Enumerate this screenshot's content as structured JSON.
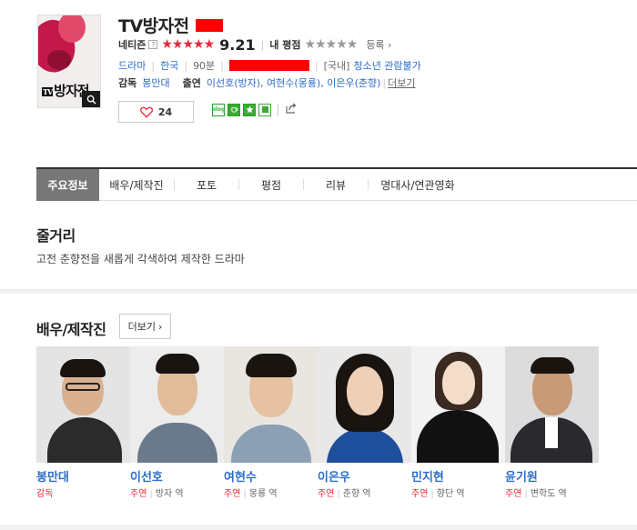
{
  "header": {
    "title": "TV방자전",
    "rating_label": "네티즌",
    "help_glyph": "?",
    "stars": "★★★★★",
    "score": "9.21",
    "my_rating_label": "내 평점",
    "my_stars": "★★★★★",
    "register_label": "등록"
  },
  "meta": {
    "genre": "드라마",
    "country": "한국",
    "runtime": "90분",
    "region": "[국내]",
    "age_rating": "청소년 관람불가"
  },
  "credits": {
    "director_label": "감독",
    "director": "봉만대",
    "cast_label": "출연",
    "cast_list": "이선호(방자), 여현수(몽룡), 이은우(춘향)",
    "more_label": "더보기"
  },
  "actions": {
    "like_count": "24"
  },
  "poster": {
    "title_text": "방자전",
    "tv_mark": "TV"
  },
  "tabs": [
    "주요정보",
    "배우/제작진",
    "포토",
    "평점",
    "리뷰",
    "명대사/연관영화"
  ],
  "synopsis": {
    "title": "줄거리",
    "text": "고전 춘향전을 새롭게 각색하여 제작한 드라마"
  },
  "cast_section": {
    "title": "배우/제작진",
    "more_label": "더보기"
  },
  "people": [
    {
      "name": "봉만대",
      "role": "감독",
      "character": ""
    },
    {
      "name": "이선호",
      "role": "주연",
      "character": "방자 역"
    },
    {
      "name": "여현수",
      "role": "주연",
      "character": "몽룡 역"
    },
    {
      "name": "이은우",
      "role": "주연",
      "character": "춘향 역"
    },
    {
      "name": "민지현",
      "role": "주연",
      "character": "향단 역"
    },
    {
      "name": "윤기원",
      "role": "주연",
      "character": "변학도 역"
    }
  ],
  "colors": {
    "accent_red": "#e5283a",
    "link_blue": "#2d6ec9",
    "active_tab": "#777777",
    "redaction": "#ff0000"
  }
}
